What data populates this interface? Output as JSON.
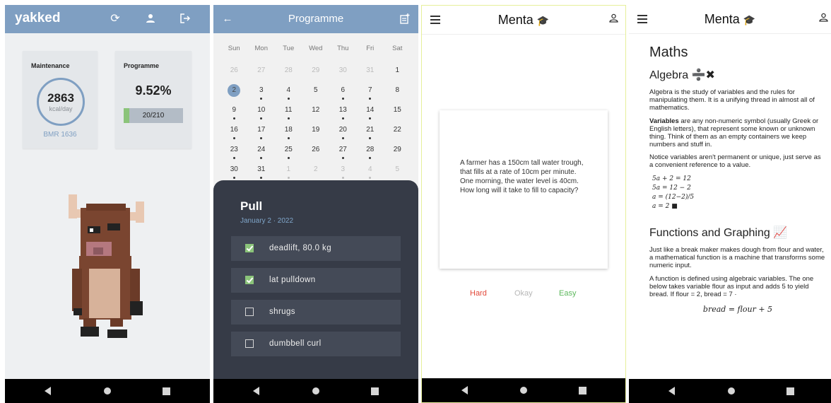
{
  "screen1": {
    "title": "yakked",
    "maintenance": {
      "label": "Maintenance",
      "value": "2863",
      "unit": "kcal/day",
      "bmr": "BMR 1636"
    },
    "programme": {
      "label": "Programme",
      "percent": "9.52%",
      "progress_text": "20/210",
      "progress_fraction": 0.0952
    },
    "icons": [
      "sync-icon",
      "account-icon",
      "logout-icon"
    ]
  },
  "screen2": {
    "title": "Programme",
    "weekdays": [
      "Sun",
      "Mon",
      "Tue",
      "Wed",
      "Thu",
      "Fri",
      "Sat"
    ],
    "weeks": [
      [
        "26",
        "27",
        "28",
        "29",
        "30",
        "31",
        "1"
      ],
      [
        "2",
        "3",
        "4",
        "5",
        "6",
        "7",
        "8"
      ],
      [
        "9",
        "10",
        "11",
        "12",
        "13",
        "14",
        "15"
      ],
      [
        "16",
        "17",
        "18",
        "19",
        "20",
        "21",
        "22"
      ],
      [
        "23",
        "24",
        "25",
        "26",
        "27",
        "28",
        "29"
      ],
      [
        "30",
        "31",
        "1",
        "2",
        "3",
        "4",
        "5"
      ]
    ],
    "selected_day": "2",
    "workout_title": "Pull",
    "workout_date": "January 2 · 2022",
    "exercises": [
      {
        "label": "deadlift, 80.0 kg",
        "checked": true
      },
      {
        "label": "lat pulldown",
        "checked": true
      },
      {
        "label": "shrugs",
        "checked": false
      },
      {
        "label": "dumbbell curl",
        "checked": false
      }
    ]
  },
  "screen3": {
    "app_title": "Menta",
    "question_line1": "A farmer has a 150cm tall water trough, that fills at a rate of 10cm per minute. One morning, the water level is 40cm.",
    "question_line2": "How long will it take to fill to capacity?",
    "grade_hard": "Hard",
    "grade_okay": "Okay",
    "grade_easy": "Easy",
    "colors": {
      "hard": "#e24a3b",
      "okay": "#b7b7b7",
      "easy": "#5cb85c"
    }
  },
  "screen4": {
    "app_title": "Menta",
    "heading": "Maths",
    "section1_title": "Algebra ➗✖",
    "p1": "Algebra is the study of variables and the rules for manipulating them. It is a unifying thread in almost all of mathematics.",
    "p2_bold": "Variables",
    "p2_rest": " are any non-numeric symbol (usually Greek or English letters), that represent some known or unknown thing. Think of them as an empty containers we keep numbers and stuff in.",
    "p3": "Notice variables aren't permanent or unique, just serve as a convenient reference to a value.",
    "eq1": "5a + 2 = 12",
    "eq2": "5a = 12 − 2",
    "eq3": "a = (12−2)/5",
    "eq4": "a = 2 ■",
    "section2_title": "Functions and Graphing 📈",
    "p4": "Just like a break maker makes dough from flour and water, a mathematical function is a machine that transforms some numeric input.",
    "p5": "A function is defined using algebraic variables. The one below takes variable flour as input and adds 5 to yield bread. If flour = 2, bread = 7 ·",
    "eq5": "bread = flour + 5"
  }
}
